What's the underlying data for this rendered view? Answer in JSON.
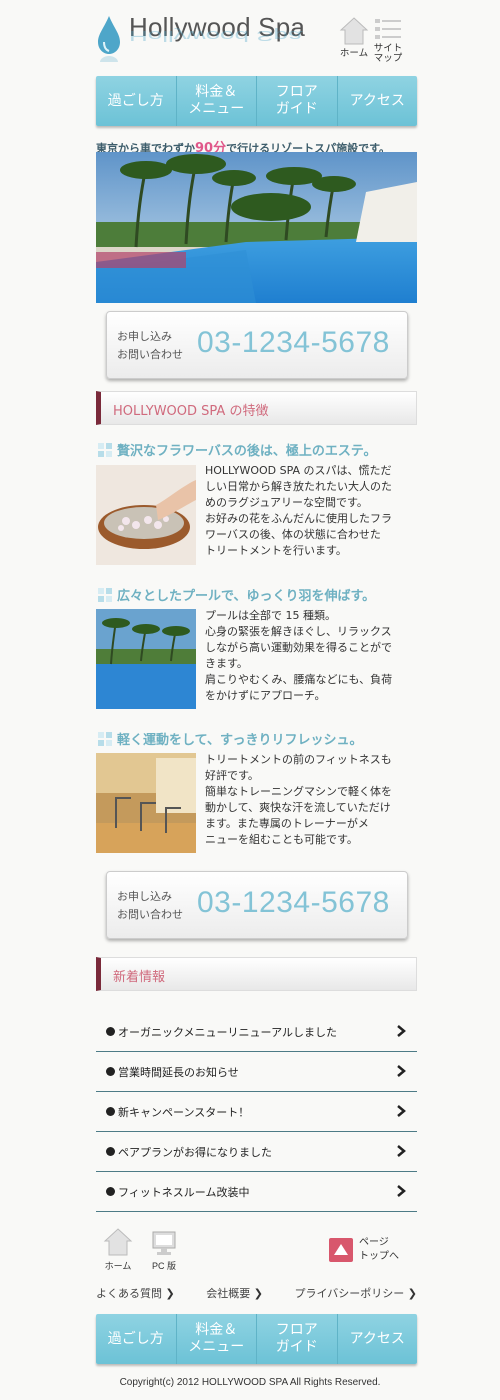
{
  "header": {
    "logo_text": "Hollywood Spa",
    "home_label": "ホーム",
    "sitemap_label_1": "サイト",
    "sitemap_label_2": "マップ"
  },
  "nav": {
    "items": [
      {
        "label_1": "過ごし方",
        "label_2": ""
      },
      {
        "label_1": "料金＆",
        "label_2": "メニュー"
      },
      {
        "label_1": "フロア",
        "label_2": "ガイド"
      },
      {
        "label_1": "アクセス",
        "label_2": ""
      }
    ]
  },
  "tagline": {
    "pre": "東京から車でわずか",
    "highlight": "90分",
    "post": "で行けるリゾートスパ施設です。"
  },
  "contact": {
    "label_1": "お申し込み",
    "label_2": "お問い合わせ",
    "phone": "03-1234-5678"
  },
  "features": {
    "heading": "HOLLYWOOD SPA の特徴",
    "items": [
      {
        "title": "贅沢なフラワーバスの後は、極上のエステ。",
        "lines": [
          "HOLLYWOOD SPA のスパは、慌ただ",
          "しい日常から解き放たれたい大人のた",
          "めのラグジュアリーな空間です。",
          "お好みの花をふんだんに使用したフラ",
          "ワーバスの後、体の状態に合わせた",
          "トリートメントを行います。"
        ]
      },
      {
        "title": "広々としたプールで、ゆっくり羽を伸ばす。",
        "lines": [
          "プールは全部で 15 種類。",
          "心身の緊張を解きほぐし、リラックス",
          "しながら高い運動効果を得ることがで",
          "きます。",
          "肩こりやむくみ、腰痛などにも、負荷",
          "をかけずにアプローチ。"
        ]
      },
      {
        "title": "軽く運動をして、すっきりリフレッシュ。",
        "lines": [
          "トリートメントの前のフィットネスも",
          "好評です。",
          "簡単なトレーニングマシンで軽く体を",
          "動かして、爽快な汗を流していただけ",
          "ます。また専属のトレーナーがメ",
          "ニューを組むことも可能です。"
        ]
      }
    ]
  },
  "news": {
    "heading": "新着情報",
    "items": [
      "オーガニックメニューリニューアルしました",
      "営業時間延長のお知らせ",
      "新キャンペーンスタート！",
      "ペアプランがお得になりました",
      "フィットネスルーム改装中"
    ]
  },
  "footer": {
    "home_label": "ホーム",
    "pc_label": "PC 版",
    "pagetop_1": "ページ",
    "pagetop_2": "トップへ",
    "links": [
      "よくある質問",
      "会社概要",
      "プライバシーポリシー"
    ],
    "copyright": "Copyright(c) 2012 HOLLYWOOD SPA  All Rights Reserved."
  },
  "colors": {
    "accent": "#6cc2d6",
    "phone": "#83c3d6",
    "pink": "#d06a7d",
    "pagetop": "#d8576c"
  }
}
